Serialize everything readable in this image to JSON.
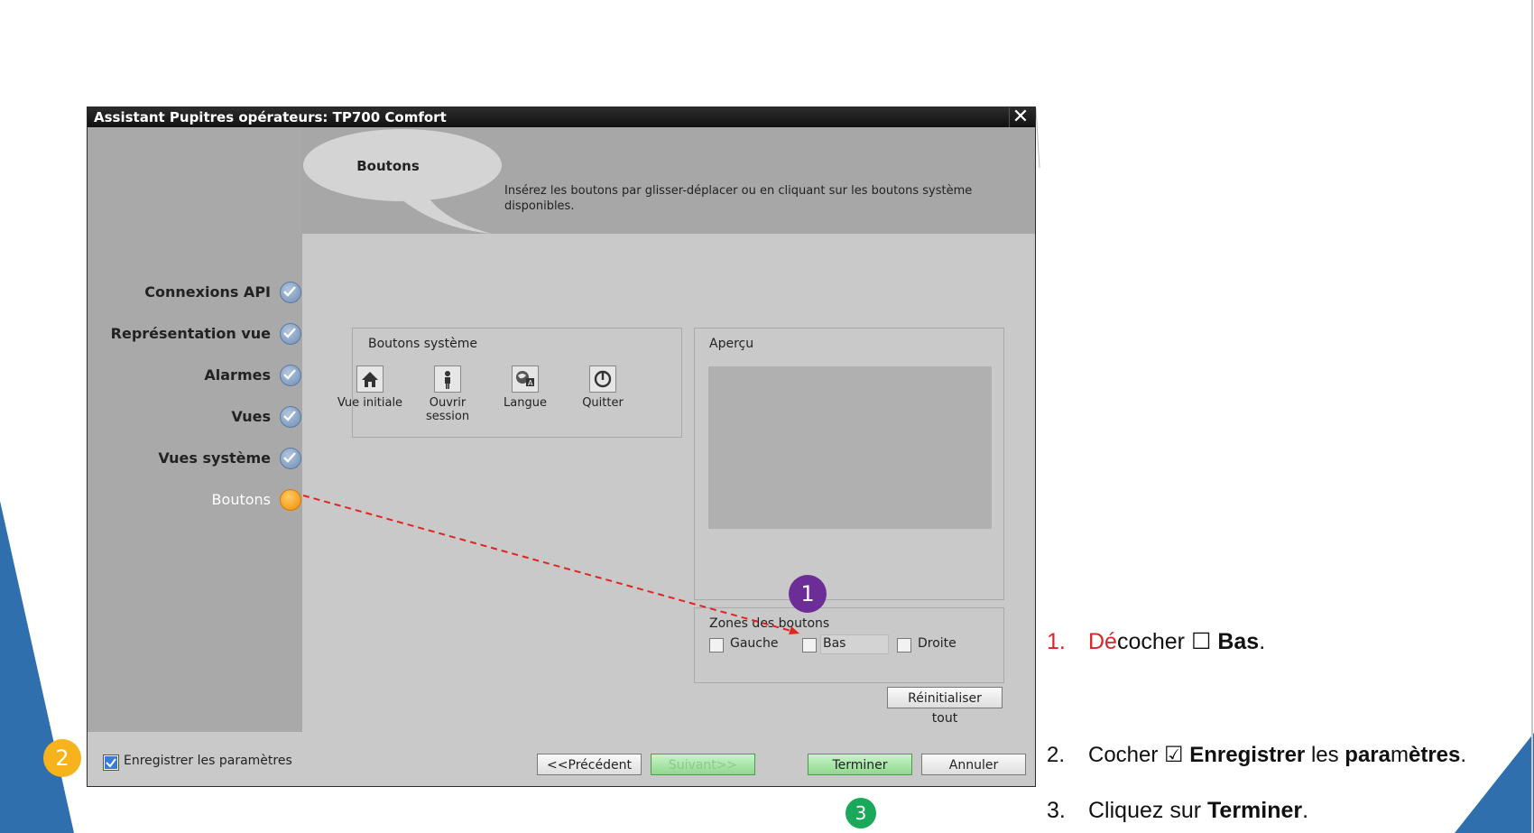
{
  "dialog": {
    "title": "Assistant Pupitres opérateurs: TP700 Comfort",
    "close_glyph": "✕",
    "header": {
      "title": "Boutons",
      "description": "Insérez les boutons par glisser-déplacer ou en cliquant sur les boutons système disponibles."
    },
    "nav": {
      "items": [
        {
          "label": "Connexions API",
          "state": "done"
        },
        {
          "label": "Représentation vue",
          "state": "done"
        },
        {
          "label": "Alarmes",
          "state": "done"
        },
        {
          "label": "Vues",
          "state": "done"
        },
        {
          "label": "Vues système",
          "state": "done"
        },
        {
          "label": "Boutons",
          "state": "active"
        }
      ]
    },
    "system_buttons": {
      "title": "Boutons système",
      "items": [
        {
          "label": "Vue initiale",
          "icon": "home-icon"
        },
        {
          "label": "Ouvrir session",
          "icon": "user-icon"
        },
        {
          "label": "Langue",
          "icon": "language-icon"
        },
        {
          "label": "Quitter",
          "icon": "power-icon"
        }
      ]
    },
    "preview": {
      "title": "Aperçu"
    },
    "zones": {
      "title": "Zones des boutons",
      "left": {
        "label": "Gauche",
        "checked": false
      },
      "bottom": {
        "label": "Bas",
        "checked": false
      },
      "right": {
        "label": "Droite",
        "checked": false
      }
    },
    "reset_label": "Réinitialiser tout",
    "footer": {
      "save_label": "Enregistrer les paramètres",
      "save_checked": true,
      "prev_label": "<<Précédent",
      "next_label": "Suivant>>",
      "finish_label": "Terminer",
      "cancel_label": "Annuler"
    }
  },
  "markers": {
    "m1": "1",
    "m2": "2",
    "m3": "3"
  },
  "instructions": {
    "step1": {
      "num": "1.",
      "red": "Dé",
      "text": "cocher ☐ ",
      "bold": "Bas",
      "end": "."
    },
    "step2": {
      "num": "2.",
      "text": "Cocher ☑ ",
      "bold1": "Enregistrer",
      "mid1": " les ",
      "bold2": "para",
      "mid2": "m",
      "bold3": "ètres",
      "end": "."
    },
    "step3": {
      "num": "3.",
      "text": "Cliquez sur ",
      "bold": "Terminer",
      "end": "."
    }
  },
  "colors": {
    "accent_blue": "#2f6fae",
    "marker_purple": "#6d2d97",
    "marker_yellow": "#f6b31b",
    "marker_green": "#1aa85b",
    "arrow_red": "#e0261f"
  }
}
